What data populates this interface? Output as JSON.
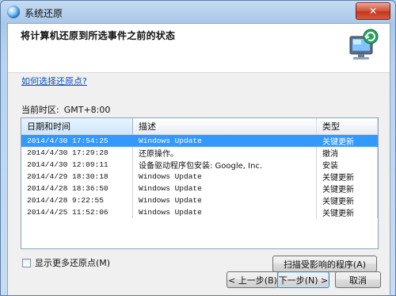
{
  "window": {
    "title": "系统还原",
    "close_label": "✕"
  },
  "header": {
    "title": "将计算机还原到所选事件之前的状态"
  },
  "help_link": "如何选择还原点?",
  "timezone": {
    "label": "当前时区:",
    "value": "GMT+8:00"
  },
  "table": {
    "columns": [
      "日期和时间",
      "描述",
      "类型"
    ],
    "rows": [
      {
        "date": "2014/4/30 17:54:25",
        "desc": "Windows Update",
        "type": "关键更新",
        "selected": true
      },
      {
        "date": "2014/4/30 17:29:28",
        "desc": "还原操作。",
        "type": "撤消",
        "selected": false
      },
      {
        "date": "2014/4/30 12:09:11",
        "desc": "设备驱动程序包安装: Google, Inc.",
        "type": "安装",
        "selected": false
      },
      {
        "date": "2014/4/29 18:30:18",
        "desc": "Windows Update",
        "type": "关键更新",
        "selected": false
      },
      {
        "date": "2014/4/28 18:36:50",
        "desc": "Windows Update",
        "type": "关键更新",
        "selected": false
      },
      {
        "date": "2014/4/28 9:22:55",
        "desc": "Windows Update",
        "type": "关键更新",
        "selected": false
      },
      {
        "date": "2014/4/25 11:52:06",
        "desc": "Windows Update",
        "type": "关键更新",
        "selected": false
      }
    ]
  },
  "show_more": {
    "label": "显示更多还原点(M)",
    "checked": false
  },
  "buttons": {
    "scan": "扫描受影响的程序(A)",
    "back": "< 上一步(B)",
    "next": "下一步(N) >",
    "cancel": "取消"
  },
  "colors": {
    "selection": "#3399ff",
    "link": "#0a4fbf"
  }
}
